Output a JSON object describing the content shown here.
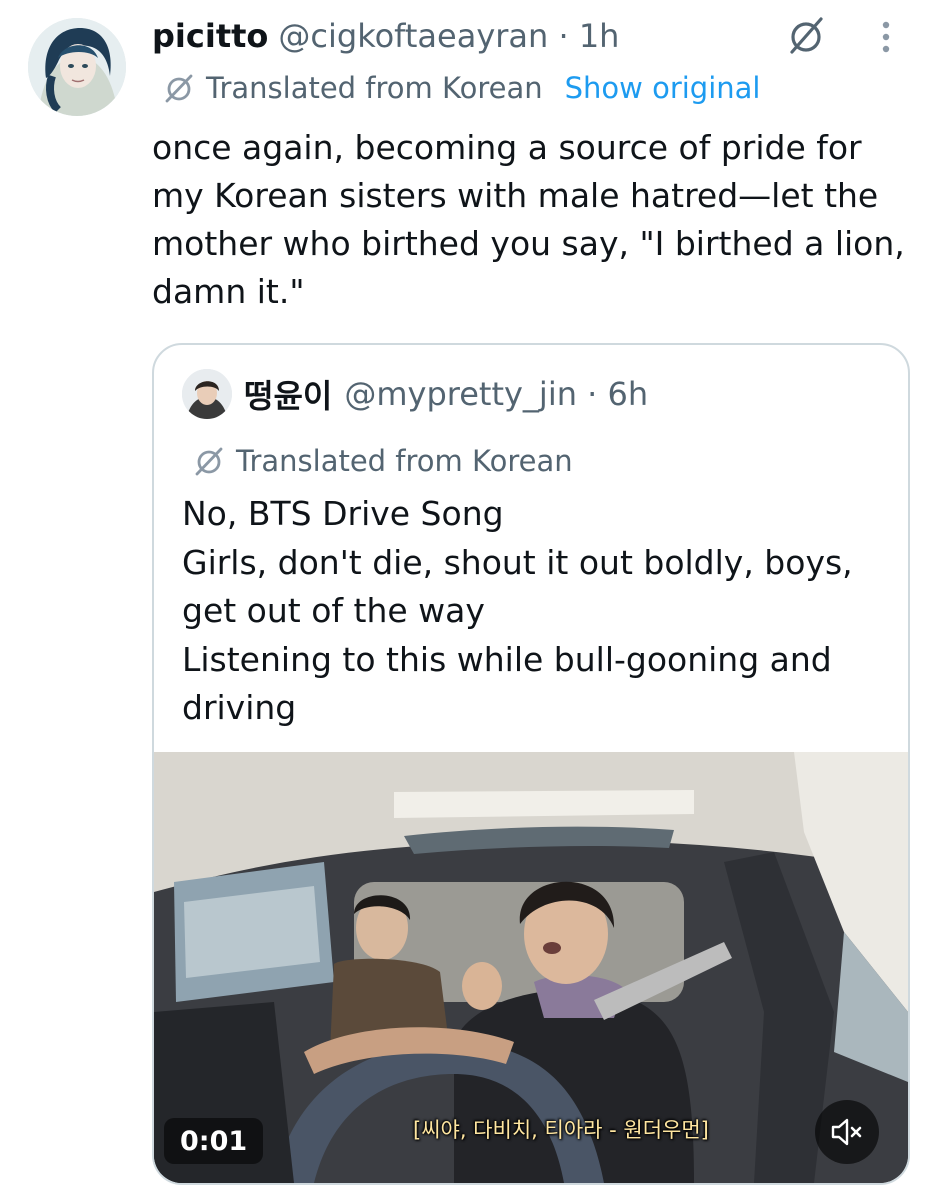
{
  "post": {
    "display_name": "picitto",
    "handle_meta": "@cigkoftaeayran · 1h",
    "translated_label": "Translated from Korean",
    "show_original_label": "Show original",
    "text_lines": [
      "once again, becoming a source of pride for",
      "my Korean sisters with male hatred—let the",
      "mother who birthed you say, \"I birthed a lion,",
      "damn it.\""
    ],
    "icons": {
      "grok": "grok-icon",
      "more": "more-vertical-icon",
      "translate": "translate-icon"
    }
  },
  "quote": {
    "display_name": "떵윤이",
    "handle_meta": "@mypretty_jin · 6h",
    "translated_label": "Translated from Korean",
    "text_lines": [
      "No, BTS Drive Song",
      "Girls, don't die, shout it out boldly, boys,",
      "get out of the way",
      "Listening to this while bull-gooning and",
      "driving"
    ],
    "video": {
      "timestamp": "0:01",
      "subtitle": "[씨야, 다비치, 티아라 - 원더우먼]",
      "mute_icon": "volume-muted-icon"
    }
  },
  "colors": {
    "text_primary": "#0f1419",
    "text_secondary": "#536471",
    "link": "#1d9bf0",
    "border": "#cfd9de"
  }
}
